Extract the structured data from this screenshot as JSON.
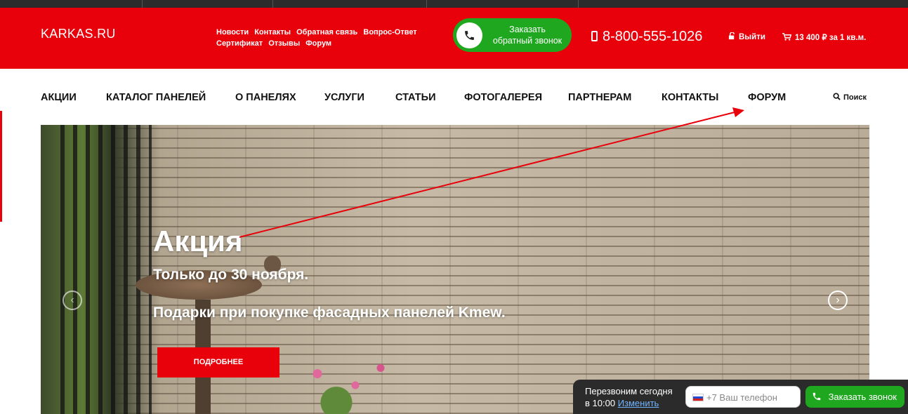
{
  "header": {
    "logo": "KARKAS.RU",
    "top_links": [
      "Новости",
      "Контакты",
      "Обратная связь",
      "Вопрос-Ответ",
      "Сертификат",
      "Отзывы",
      "Форум"
    ],
    "callback_button": {
      "line1": "Заказать",
      "line2": "обратный звонок"
    },
    "phone": "8-800-555-1026",
    "logout": "Выйти",
    "cart": "13 400 ₽ за 1 кв.м."
  },
  "nav": {
    "items": [
      "АКЦИИ",
      "КАТАЛОГ ПАНЕЛЕЙ",
      "О ПАНЕЛЯХ",
      "УСЛУГИ",
      "СТАТЬИ",
      "ФОТОГАЛЕРЕЯ",
      "ПАРТНЕРАМ",
      "КОНТАКТЫ",
      "ФОРУМ"
    ],
    "search_label": "Поиск"
  },
  "banner": {
    "title": "Акция",
    "subtitle1": "Только до 30 ноября.",
    "subtitle2": "Подарки при покупке фасадных панелей Kmew.",
    "button": "ПОДРОБНЕЕ",
    "prev_icon": "chevron-left-icon",
    "next_icon": "chevron-right-icon"
  },
  "callback_widget": {
    "line1": "Перезвоним сегодня",
    "line2_prefix": "в 10:00",
    "line2_link": "Изменить",
    "phone_placeholder": "+7 Ваш телефон",
    "button": "Заказать звонок"
  },
  "colors": {
    "brand_red": "#e8000b",
    "callback_green": "#1fa81f",
    "widget_dark": "#2b2b2b",
    "annotation_arrow": "#e8000b"
  }
}
